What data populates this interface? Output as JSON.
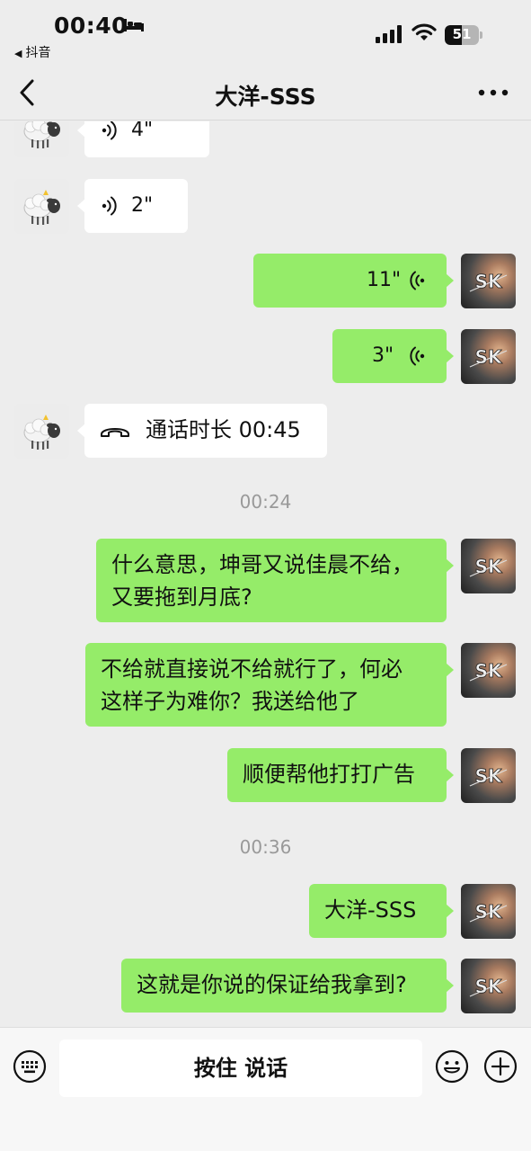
{
  "status_bar": {
    "time": "00:40",
    "back_app": "抖音",
    "battery": "51",
    "battery_level": 0.51
  },
  "nav": {
    "title": "大洋-SSS"
  },
  "messages": [
    {
      "type": "voice",
      "side": "in",
      "duration": "4\""
    },
    {
      "type": "voice",
      "side": "in",
      "duration": "2\""
    },
    {
      "type": "voice",
      "side": "out",
      "duration": "11\""
    },
    {
      "type": "voice",
      "side": "out",
      "duration": "3\""
    },
    {
      "type": "call",
      "side": "in",
      "text": "通话时长 00:45"
    },
    {
      "type": "time",
      "text": "00:24"
    },
    {
      "type": "text",
      "side": "out",
      "text": "什么意思，坤哥又说佳晨不给，\n又要拖到月底?"
    },
    {
      "type": "text",
      "side": "out",
      "text": "不给就直接说不给就行了，何必\n这样子为难你？我送给他了"
    },
    {
      "type": "text",
      "side": "out",
      "text": "顺便帮他打打广告"
    },
    {
      "type": "time",
      "text": "00:36"
    },
    {
      "type": "text",
      "side": "out",
      "text": "大洋-SSS"
    },
    {
      "type": "text",
      "side": "out",
      "text": "这就是你说的保证给我拿到?"
    }
  ],
  "input_bar": {
    "hold_to_talk": "按住 说话"
  },
  "icons": {
    "back": "chevron-left-icon",
    "more": "more-icon",
    "keyboard": "keyboard-icon",
    "emoji": "emoji-icon",
    "plus": "plus-icon",
    "voice": "voice-wave-icon",
    "call": "phone-icon"
  }
}
